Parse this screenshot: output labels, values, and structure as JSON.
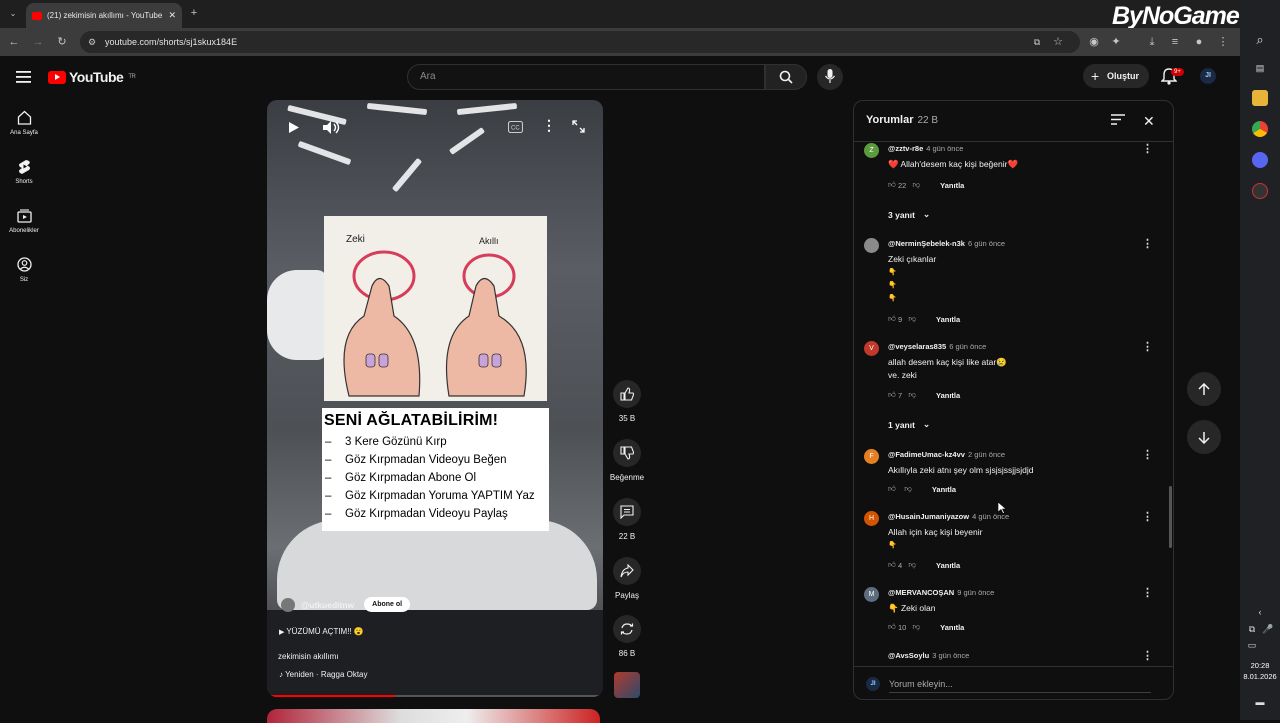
{
  "browser": {
    "tab_title": "(21) zekimisin akıllımı - YouTube",
    "url": "youtube.com/shorts/sj1skux184E",
    "watermark": "ByNoGame"
  },
  "masthead": {
    "logo_text": "YouTube",
    "region": "TR",
    "search_placeholder": "Ara",
    "create_label": "Oluştur",
    "notification_count": "9+",
    "avatar_text": "JI"
  },
  "guide": [
    {
      "label": "Ana Sayfa",
      "icon": "home-icon"
    },
    {
      "label": "Shorts",
      "icon": "shorts-icon"
    },
    {
      "label": "Abonelikler",
      "icon": "subscriptions-icon"
    },
    {
      "label": "Siz",
      "icon": "you-icon"
    }
  ],
  "video": {
    "card_labels": [
      "Zeki",
      "Akıllı"
    ],
    "card_heading": "SENİ AĞLATABİLİRİM!",
    "card_items": [
      "3 Kere Gözünü Kırp",
      "Göz Kırpmadan Videoyu Beğen",
      "Göz Kırpmadan Abone Ol",
      "Göz Kırpmadan Yoruma YAPTIM Yaz",
      "Göz Kırpmadan Videoyu Paylaş"
    ],
    "card_item_dash": "–",
    "channel": "@utkueditnw",
    "subscribe_label": "Abone ol",
    "caption": "YÜZÜMÜ AÇTIM!! 😮",
    "title": "zekimisin akıllımı",
    "music": "Yeniden · Ragga Oktay",
    "progress": 0.38
  },
  "actions": {
    "like_count": "35 B",
    "dislike_label": "Beğenme",
    "comment_count": "22 B",
    "share_label": "Paylaş",
    "remix_count": "86 B"
  },
  "comments": {
    "title": "Yorumlar",
    "count": "22 B",
    "reply_label": "Yanıtla",
    "input_placeholder": "Yorum ekleyin...",
    "items": [
      {
        "avatar": "Z",
        "color": "#5b9a3d",
        "user": "@zztv-r8e",
        "time": "4 gün önce",
        "lines": [
          "❤️ Allah'desem kaç kişi beğenir❤️"
        ],
        "likes": "22",
        "replies": "3 yanıt"
      },
      {
        "avatar": "",
        "color": "#8a8a8a",
        "user": "@NerminŞebelek-n3k",
        "time": "6 gün önce",
        "lines": [
          "Zeki çıkanlar",
          "👇",
          "👇",
          "👇"
        ],
        "likes": "9",
        "replies": ""
      },
      {
        "avatar": "V",
        "color": "#c0392b",
        "user": "@veyselaras835",
        "time": "6 gün önce",
        "lines": [
          "allah desem kaç kişi like atar😢",
          "ve. zeki"
        ],
        "likes": "7",
        "replies": "1 yanıt"
      },
      {
        "avatar": "F",
        "color": "#e67e22",
        "user": "@FadimeUmac-kz4vv",
        "time": "2 gün önce",
        "lines": [
          "Akıllıyla zeki atnı şey olm sjsjsjssjjsjdjd"
        ],
        "likes": "",
        "replies": ""
      },
      {
        "avatar": "H",
        "color": "#d35400",
        "user": "@HusainJumaniyazow",
        "time": "4 gün önce",
        "lines": [
          "Allah için kaç kişi beyenir",
          "👇"
        ],
        "likes": "4",
        "replies": ""
      },
      {
        "avatar": "M",
        "color": "#5d6d7e",
        "user": "@MERVANCOŞAN",
        "time": "9 gün önce",
        "lines": [
          "👇 Zeki olan"
        ],
        "likes": "10",
        "replies": ""
      },
      {
        "avatar": "",
        "color": "#555",
        "user": "@AvsSoylu",
        "time": "3 gün önce",
        "lines": [],
        "likes": "",
        "replies": ""
      }
    ]
  },
  "taskbar": {
    "time": "20:28",
    "date": "8.01.2026"
  }
}
